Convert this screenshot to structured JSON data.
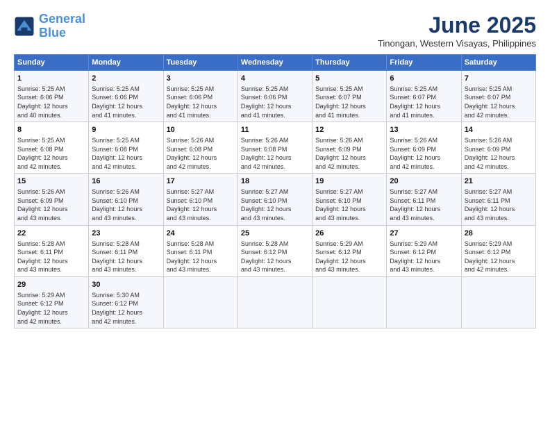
{
  "logo": {
    "line1": "General",
    "line2": "Blue"
  },
  "title": "June 2025",
  "subtitle": "Tinongan, Western Visayas, Philippines",
  "days_of_week": [
    "Sunday",
    "Monday",
    "Tuesday",
    "Wednesday",
    "Thursday",
    "Friday",
    "Saturday"
  ],
  "weeks": [
    [
      {
        "day": "1",
        "info": "Sunrise: 5:25 AM\nSunset: 6:06 PM\nDaylight: 12 hours\nand 40 minutes."
      },
      {
        "day": "2",
        "info": "Sunrise: 5:25 AM\nSunset: 6:06 PM\nDaylight: 12 hours\nand 41 minutes."
      },
      {
        "day": "3",
        "info": "Sunrise: 5:25 AM\nSunset: 6:06 PM\nDaylight: 12 hours\nand 41 minutes."
      },
      {
        "day": "4",
        "info": "Sunrise: 5:25 AM\nSunset: 6:06 PM\nDaylight: 12 hours\nand 41 minutes."
      },
      {
        "day": "5",
        "info": "Sunrise: 5:25 AM\nSunset: 6:07 PM\nDaylight: 12 hours\nand 41 minutes."
      },
      {
        "day": "6",
        "info": "Sunrise: 5:25 AM\nSunset: 6:07 PM\nDaylight: 12 hours\nand 41 minutes."
      },
      {
        "day": "7",
        "info": "Sunrise: 5:25 AM\nSunset: 6:07 PM\nDaylight: 12 hours\nand 42 minutes."
      }
    ],
    [
      {
        "day": "8",
        "info": "Sunrise: 5:25 AM\nSunset: 6:08 PM\nDaylight: 12 hours\nand 42 minutes."
      },
      {
        "day": "9",
        "info": "Sunrise: 5:25 AM\nSunset: 6:08 PM\nDaylight: 12 hours\nand 42 minutes."
      },
      {
        "day": "10",
        "info": "Sunrise: 5:26 AM\nSunset: 6:08 PM\nDaylight: 12 hours\nand 42 minutes."
      },
      {
        "day": "11",
        "info": "Sunrise: 5:26 AM\nSunset: 6:08 PM\nDaylight: 12 hours\nand 42 minutes."
      },
      {
        "day": "12",
        "info": "Sunrise: 5:26 AM\nSunset: 6:09 PM\nDaylight: 12 hours\nand 42 minutes."
      },
      {
        "day": "13",
        "info": "Sunrise: 5:26 AM\nSunset: 6:09 PM\nDaylight: 12 hours\nand 42 minutes."
      },
      {
        "day": "14",
        "info": "Sunrise: 5:26 AM\nSunset: 6:09 PM\nDaylight: 12 hours\nand 42 minutes."
      }
    ],
    [
      {
        "day": "15",
        "info": "Sunrise: 5:26 AM\nSunset: 6:09 PM\nDaylight: 12 hours\nand 43 minutes."
      },
      {
        "day": "16",
        "info": "Sunrise: 5:26 AM\nSunset: 6:10 PM\nDaylight: 12 hours\nand 43 minutes."
      },
      {
        "day": "17",
        "info": "Sunrise: 5:27 AM\nSunset: 6:10 PM\nDaylight: 12 hours\nand 43 minutes."
      },
      {
        "day": "18",
        "info": "Sunrise: 5:27 AM\nSunset: 6:10 PM\nDaylight: 12 hours\nand 43 minutes."
      },
      {
        "day": "19",
        "info": "Sunrise: 5:27 AM\nSunset: 6:10 PM\nDaylight: 12 hours\nand 43 minutes."
      },
      {
        "day": "20",
        "info": "Sunrise: 5:27 AM\nSunset: 6:11 PM\nDaylight: 12 hours\nand 43 minutes."
      },
      {
        "day": "21",
        "info": "Sunrise: 5:27 AM\nSunset: 6:11 PM\nDaylight: 12 hours\nand 43 minutes."
      }
    ],
    [
      {
        "day": "22",
        "info": "Sunrise: 5:28 AM\nSunset: 6:11 PM\nDaylight: 12 hours\nand 43 minutes."
      },
      {
        "day": "23",
        "info": "Sunrise: 5:28 AM\nSunset: 6:11 PM\nDaylight: 12 hours\nand 43 minutes."
      },
      {
        "day": "24",
        "info": "Sunrise: 5:28 AM\nSunset: 6:11 PM\nDaylight: 12 hours\nand 43 minutes."
      },
      {
        "day": "25",
        "info": "Sunrise: 5:28 AM\nSunset: 6:12 PM\nDaylight: 12 hours\nand 43 minutes."
      },
      {
        "day": "26",
        "info": "Sunrise: 5:29 AM\nSunset: 6:12 PM\nDaylight: 12 hours\nand 43 minutes."
      },
      {
        "day": "27",
        "info": "Sunrise: 5:29 AM\nSunset: 6:12 PM\nDaylight: 12 hours\nand 43 minutes."
      },
      {
        "day": "28",
        "info": "Sunrise: 5:29 AM\nSunset: 6:12 PM\nDaylight: 12 hours\nand 42 minutes."
      }
    ],
    [
      {
        "day": "29",
        "info": "Sunrise: 5:29 AM\nSunset: 6:12 PM\nDaylight: 12 hours\nand 42 minutes."
      },
      {
        "day": "30",
        "info": "Sunrise: 5:30 AM\nSunset: 6:12 PM\nDaylight: 12 hours\nand 42 minutes."
      },
      {
        "day": "",
        "info": ""
      },
      {
        "day": "",
        "info": ""
      },
      {
        "day": "",
        "info": ""
      },
      {
        "day": "",
        "info": ""
      },
      {
        "day": "",
        "info": ""
      }
    ]
  ]
}
